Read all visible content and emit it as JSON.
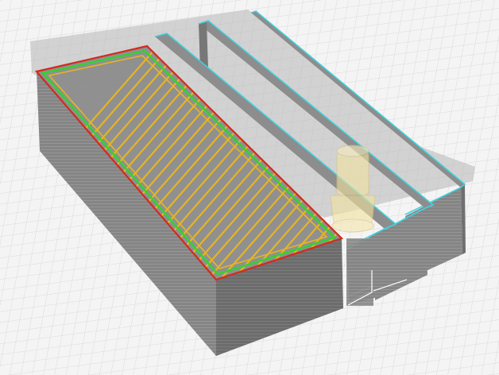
{
  "viewer": {
    "colors": {
      "background": "#f4f4f4",
      "grid_minor": "#d8d8d8",
      "grid_major": "#c4c4c4",
      "model_top": "#7d7d7d",
      "model_front": "#8c8c8c",
      "model_side": "#6f6f6f",
      "shadow": "#b9b9b9",
      "outer_perimeter": "#d42a1e",
      "inner_perimeter": "#2fd42f",
      "infill": "#e6b422",
      "travel_outline": "#3fd2e0",
      "nozzle": "#f0e09a"
    },
    "objects": [
      {
        "name": "solid-box-with-infill",
        "layer_lines": [
          "outer-perimeter",
          "inner-perimeter",
          "diagonal-infill"
        ]
      },
      {
        "name": "thin-wall-1",
        "outline": "travel-outline"
      },
      {
        "name": "thin-wall-2",
        "outline": "travel-outline"
      },
      {
        "name": "thin-wall-3",
        "outline": "travel-outline"
      }
    ],
    "tool": {
      "name": "nozzle-preview"
    }
  }
}
